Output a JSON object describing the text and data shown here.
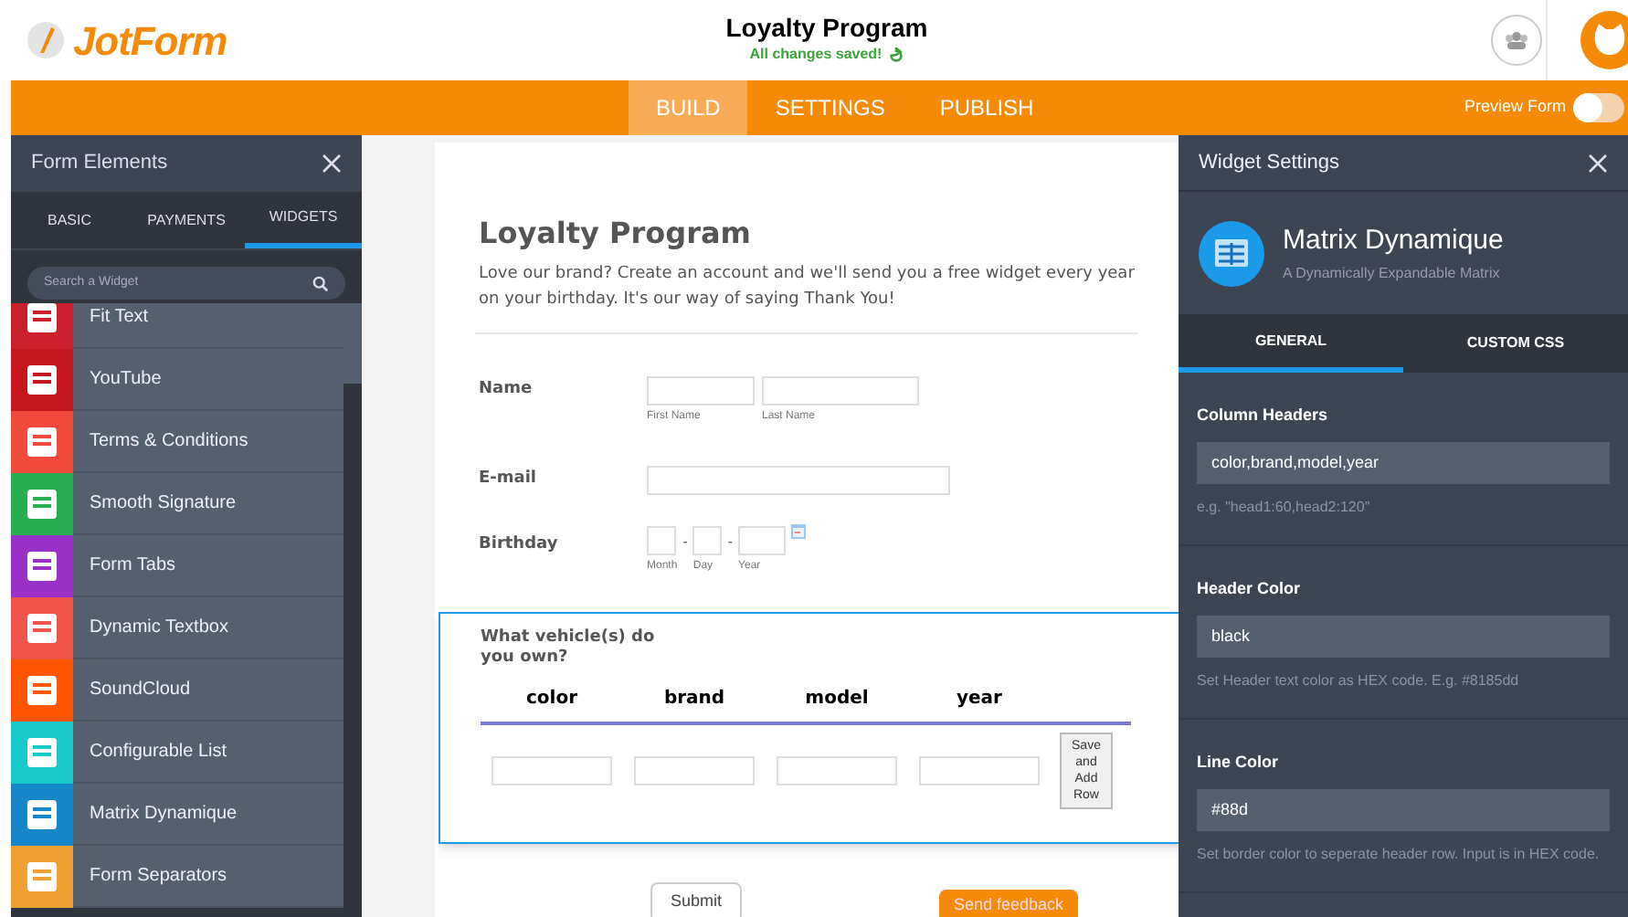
{
  "header": {
    "logo": "JotForm",
    "title": "Loyalty Program",
    "save_status": "All changes saved!"
  },
  "nav": {
    "tabs": [
      {
        "label": "BUILD",
        "selected": true
      },
      {
        "label": "SETTINGS",
        "selected": false
      },
      {
        "label": "PUBLISH",
        "selected": false
      }
    ],
    "preview": {
      "label": "Preview Form",
      "on": false
    }
  },
  "left_panel": {
    "title": "Form Elements",
    "tabs": [
      {
        "label": "BASIC",
        "selected": false
      },
      {
        "label": "PAYMENTS",
        "selected": false
      },
      {
        "label": "WIDGETS",
        "selected": true
      }
    ],
    "search": {
      "placeholder": "Search a Widget"
    },
    "items": [
      {
        "label": "Fit Text",
        "color": "#c9202c"
      },
      {
        "label": "YouTube",
        "color": "#c4161c"
      },
      {
        "label": "Terms & Conditions",
        "color": "#f04a3c"
      },
      {
        "label": "Smooth Signature",
        "color": "#27ae4f"
      },
      {
        "label": "Form Tabs",
        "color": "#9b30c8"
      },
      {
        "label": "Dynamic Textbox",
        "color": "#ee5548"
      },
      {
        "label": "SoundCloud",
        "color": "#ff5500"
      },
      {
        "label": "Configurable List",
        "color": "#17c9c9"
      },
      {
        "label": "Matrix Dynamique",
        "color": "#1486c9"
      },
      {
        "label": "Form Separators",
        "color": "#f0a030"
      }
    ]
  },
  "form": {
    "title": "Loyalty Program",
    "description": "Love our brand? Create an account and we'll send you a free widget every year on your birthday. It's our way of saying Thank You!",
    "name": {
      "label": "Name",
      "sublabels": [
        "First Name",
        "Last Name"
      ]
    },
    "email": {
      "label": "E-mail"
    },
    "birthday": {
      "label": "Birthday",
      "separator": "-",
      "sublabels": [
        "Month",
        "Day",
        "Year"
      ]
    },
    "matrix": {
      "question": "What vehicle(s) do you own?",
      "selected": true,
      "columns": [
        "color",
        "brand",
        "model",
        "year"
      ],
      "button": "Save and Add Row"
    },
    "submit": "Submit",
    "feedback": "Send feedback"
  },
  "right_panel": {
    "title": "Widget Settings",
    "widget": {
      "name": "Matrix Dynamique",
      "subtitle": "A Dynamically Expandable Matrix"
    },
    "tabs": [
      {
        "label": "GENERAL",
        "selected": true
      },
      {
        "label": "CUSTOM CSS",
        "selected": false
      }
    ],
    "settings": [
      {
        "label": "Column Headers",
        "value": "color,brand,model,year",
        "hint": "e.g. \"head1:60,head2:120\""
      },
      {
        "label": "Header Color",
        "value": "black",
        "hint": "Set Header text color as HEX code. E.g. #8185dd"
      },
      {
        "label": "Line Color",
        "value": "#88d",
        "hint": "Set border color to seperate header row. Input is in HEX code."
      }
    ]
  }
}
